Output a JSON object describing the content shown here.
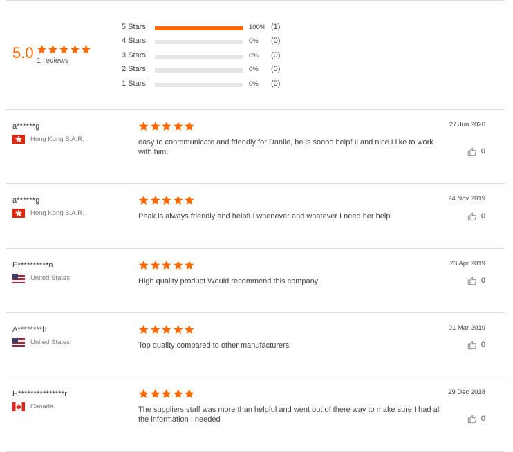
{
  "colors": {
    "accent": "#ff6a00",
    "track": "#e6e6e6",
    "divider": "#dddddd"
  },
  "summary": {
    "average": "5.0",
    "average_stars": 5,
    "count_label": "1 reviews",
    "distribution": [
      {
        "label": "5 Stars",
        "fraction": 1.0,
        "percent": "100%",
        "count": "(1)"
      },
      {
        "label": "4 Stars",
        "fraction": 0.0,
        "percent": "0%",
        "count": "(0)"
      },
      {
        "label": "3 Stars",
        "fraction": 0.0,
        "percent": "0%",
        "count": "(0)"
      },
      {
        "label": "2 Stars",
        "fraction": 0.0,
        "percent": "0%",
        "count": "(0)"
      },
      {
        "label": "1 Stars",
        "fraction": 0.0,
        "percent": "0%",
        "count": "(0)"
      }
    ]
  },
  "reviews": [
    {
      "name": "a******g",
      "country": "Hong Kong S.A.R.",
      "flag_icon": "hong-kong-flag-icon",
      "stars": 5,
      "text": "easy to conmmunicate and friendly for Danile, he is soooo helpful and nice.I like to work with him.",
      "date": "27 Jun 2020",
      "helpful_count": "0"
    },
    {
      "name": "a******g",
      "country": "Hong Kong S.A.R.",
      "flag_icon": "hong-kong-flag-icon",
      "stars": 5,
      "text": "Peak is always friendly and helpful whenever and whatever I need her help.",
      "date": "24 Nov 2019",
      "helpful_count": "0"
    },
    {
      "name": "E**********n",
      "country": "United States",
      "flag_icon": "us-flag-icon",
      "stars": 5,
      "text": "High quality product.Would recommend this company.",
      "date": "23 Apr 2019",
      "helpful_count": "0"
    },
    {
      "name": "A********h",
      "country": "United States",
      "flag_icon": "us-flag-icon",
      "stars": 5,
      "text": "Top quality compared to other manufacturers",
      "date": "01 Mar 2019",
      "helpful_count": "0"
    },
    {
      "name": "H***************r",
      "country": "Canada",
      "flag_icon": "canada-flag-icon",
      "stars": 5,
      "text": "The suppliers staff was more than helpful and went out of there way to make sure I had all the information I needed",
      "date": "29 Dec 2018",
      "helpful_count": "0"
    }
  ]
}
